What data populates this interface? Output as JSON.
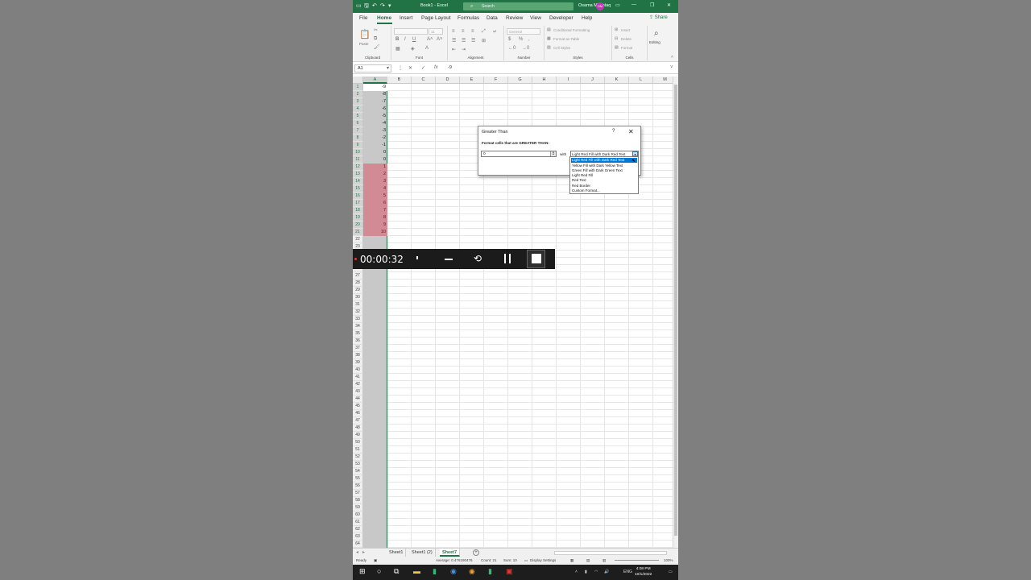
{
  "titlebar": {
    "doc_title": "Book1 - Excel",
    "search_placeholder": "Search",
    "user_name": "Osama Mushtaq",
    "user_initials": "OM"
  },
  "menu": {
    "tabs": [
      "File",
      "Home",
      "Insert",
      "Page Layout",
      "Formulas",
      "Data",
      "Review",
      "View",
      "Developer",
      "Help"
    ],
    "active_tab": "Home",
    "share_label": "Share"
  },
  "ribbon": {
    "clipboard": {
      "label": "Clipboard",
      "paste": "Paste"
    },
    "font": {
      "label": "Font",
      "font_name": "",
      "font_size": "11"
    },
    "alignment": {
      "label": "Alignment"
    },
    "number": {
      "label": "Number",
      "format": "General"
    },
    "styles": {
      "label": "Styles",
      "conditional": "Conditional Formatting",
      "table": "Format as Table",
      "cell_styles": "Cell Styles"
    },
    "cells": {
      "label": "Cells",
      "insert": "Insert",
      "delete": "Delete",
      "format": "Format"
    },
    "editing": {
      "label": "Editing"
    }
  },
  "formula_bar": {
    "name_box": "A1",
    "fx": "fx",
    "value": "-9"
  },
  "columns": [
    "A",
    "B",
    "C",
    "D",
    "E",
    "F",
    "G",
    "H",
    "I",
    "J",
    "K",
    "L",
    "M"
  ],
  "rows": [
    "1",
    "2",
    "3",
    "4",
    "5",
    "6",
    "7",
    "8",
    "9",
    "10",
    "11",
    "12",
    "13",
    "14",
    "15",
    "16",
    "17",
    "18",
    "19",
    "20",
    "21",
    "22",
    "23",
    "24",
    "25",
    "26",
    "27",
    "28",
    "29",
    "30",
    "31",
    "32",
    "33",
    "34",
    "35",
    "36",
    "37",
    "38",
    "39",
    "40",
    "41",
    "42",
    "43",
    "44",
    "45",
    "46",
    "47",
    "48",
    "49",
    "50",
    "51",
    "52",
    "53",
    "54",
    "55",
    "56",
    "57",
    "58",
    "59",
    "60",
    "61",
    "62",
    "63",
    "64"
  ],
  "column_a_values": [
    "-9",
    "-8",
    "-7",
    "-6",
    "-5",
    "-4",
    "-3",
    "-2",
    "-1",
    "0",
    "0",
    "1",
    "2",
    "3",
    "4",
    "5",
    "6",
    "7",
    "8",
    "9",
    "10"
  ],
  "highlight_color": "#d28b95",
  "dialog": {
    "title": "Greater Than",
    "help": "?",
    "close": "✕",
    "prompt": "Format cells that are GREATER THAN:",
    "value": "0",
    "with_label": "with",
    "selected_format": "Light Red Fill with Dark Red Text",
    "options": [
      "Light Red Fill with Dark Red Text",
      "Yellow Fill with Dark Yellow Text",
      "Green Fill with Dark Green Text",
      "Light Red Fill",
      "Red Text",
      "Red Border",
      "Custom Format..."
    ]
  },
  "recorder": {
    "elapsed": "00:00:32"
  },
  "sheets": {
    "tabs": [
      "Sheet1",
      "Sheet1 (2)",
      "Sheet7"
    ],
    "active": "Sheet7"
  },
  "status": {
    "ready": "Ready",
    "average": "Average: 0.476190476",
    "count": "Count: 21",
    "sum": "Sum: 10",
    "display_settings": "Display Settings",
    "zoom": "100%"
  },
  "taskbar": {
    "lang": "ENG",
    "time": "4:08 PM",
    "date": "10/1/2022"
  },
  "accent_color": "#217346"
}
